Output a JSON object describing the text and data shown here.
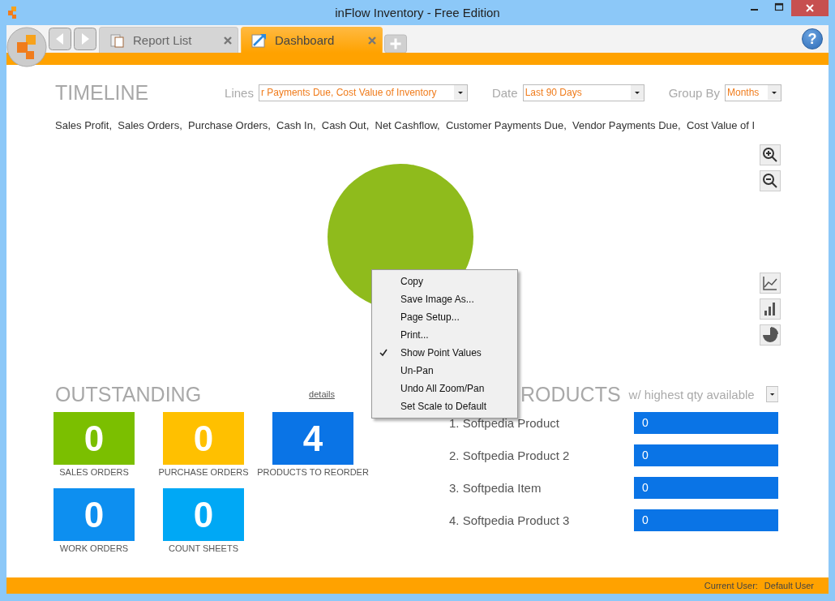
{
  "window": {
    "title": "inFlow Inventory - Free Edition"
  },
  "help": "?",
  "tabs": [
    {
      "label": "Report List",
      "selected": false
    },
    {
      "label": "Dashboard",
      "selected": true
    }
  ],
  "timeline": {
    "title": "TIMELINE",
    "filters": [
      {
        "label": "Lines",
        "value": "r Payments Due, Cost Value of Inventory"
      },
      {
        "label": "Date",
        "value": "Last 90 Days"
      },
      {
        "label": "Group By",
        "value": "Months"
      }
    ],
    "legend": "Sales Profit,  Sales Orders,  Purchase Orders,  Cash In,  Cash Out,  Net Cashflow,  Customer Payments Due,  Vendor Payments Due,  Cost Value of I"
  },
  "context_menu": [
    {
      "label": "Copy",
      "checked": false
    },
    {
      "label": "Save Image As...",
      "checked": false
    },
    {
      "label": "Page Setup...",
      "checked": false
    },
    {
      "label": "Print...",
      "checked": false
    },
    {
      "label": "Show Point Values",
      "checked": true
    },
    {
      "label": "Un-Pan",
      "checked": false
    },
    {
      "label": "Undo All Zoom/Pan",
      "checked": false
    },
    {
      "label": "Set Scale to Default",
      "checked": false
    }
  ],
  "outstanding": {
    "title": "OUTSTANDING",
    "details": "details",
    "tiles": [
      {
        "value": "0",
        "label": "SALES ORDERS",
        "color": "#7bbf00"
      },
      {
        "value": "0",
        "label": "PURCHASE ORDERS",
        "color": "#ffc000"
      },
      {
        "value": "4",
        "label": "PRODUCTS TO REORDER",
        "color": "#0a74e6"
      },
      {
        "value": "0",
        "label": "WORK ORDERS",
        "color": "#0d8ff0"
      },
      {
        "value": "0",
        "label": "COUNT SHEETS",
        "color": "#00a8f5"
      }
    ]
  },
  "top_products": {
    "title": "RODUCTS",
    "subtitle": "w/ highest qty available",
    "rows": [
      {
        "name": "1. Softpedia Product",
        "value": "0"
      },
      {
        "name": "2. Softpedia Product 2",
        "value": "0"
      },
      {
        "name": "3. Softpedia Item",
        "value": "0"
      },
      {
        "name": "4. Softpedia Product 3",
        "value": "0"
      }
    ]
  },
  "status_bar": {
    "label": "Current User:",
    "value": "Default User"
  }
}
